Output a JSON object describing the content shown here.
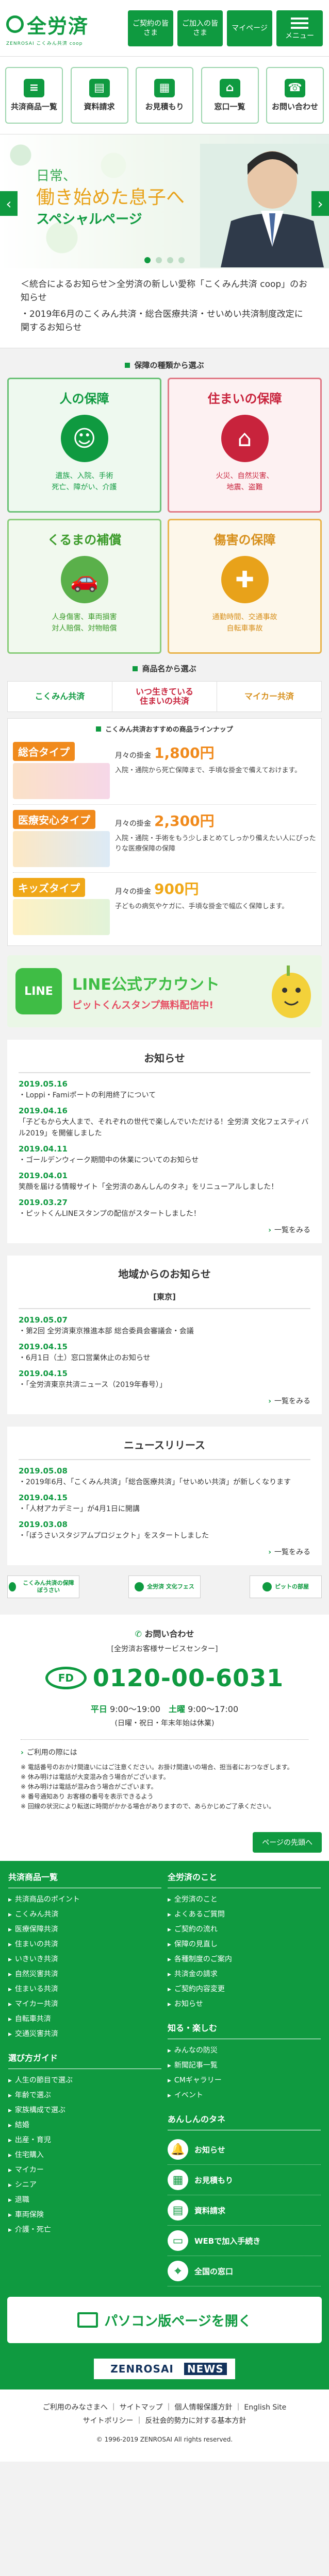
{
  "header": {
    "logo_text": "全労済",
    "logo_sub": "ZENROSAI こくみん共済 coop",
    "buttons": [
      "ご契約の皆さま",
      "ご加入の皆さま",
      "マイページ"
    ],
    "menu_label": "メニュー"
  },
  "nav": [
    {
      "label": "共済商品一覧",
      "icon": "list-icon"
    },
    {
      "label": "資料請求",
      "icon": "document-icon"
    },
    {
      "label": "お見積もり",
      "icon": "calculator-icon"
    },
    {
      "label": "窓口一覧",
      "icon": "shop-icon"
    },
    {
      "label": "お問い合わせ",
      "icon": "headset-icon"
    }
  ],
  "hero": {
    "line1": "日常、",
    "line2": "働き始めた息子へ",
    "line3": "スペシャルページ"
  },
  "notices": [
    "＜統合によるお知らせ＞全労済の新しい愛称「こくみん共済 coop」のお知らせ",
    "・2019年6月のこくみん共済・総合医療共済・せいめい共済制度改定に関するお知らせ"
  ],
  "products": {
    "section_title": "保障の種類から選ぶ",
    "cards": [
      {
        "title": "人の保障",
        "desc": "遺族、入院、手術\n死亡、障がい、介護",
        "icon": "person-icon"
      },
      {
        "title": "住まいの保障",
        "desc": "火災、自然災害、\n地震、盗難",
        "icon": "house-icon"
      },
      {
        "title": "くるまの補償",
        "desc": "人身傷害、車両損害\n対人賠償、対物賠償",
        "icon": "car-icon"
      },
      {
        "title": "傷害の保障",
        "desc": "通勤時間、交通事故\n自転車事故",
        "icon": "bandage-icon"
      }
    ],
    "name_title": "商品名から選ぶ",
    "tabs": [
      "こくみん共済",
      "いつ生きている\n住まいの共済",
      "マイカー共済"
    ],
    "plans_title": "こくみん共済おすすめの商品ラインナップ",
    "plans": [
      {
        "tag": "総合タイプ",
        "price_label": "月々の掛金",
        "price": "1,800円",
        "desc": "入院・通院から死亡保障まで、手頃な掛金で備えておけます。"
      },
      {
        "tag": "医療安心タイプ",
        "price_label": "月々の掛金",
        "price": "2,300円",
        "desc": "入院・通院・手術をもう少しまとめてしっかり備えたい人にぴったりな医療保障の保障"
      },
      {
        "tag": "キッズタイプ",
        "price_label": "月々の掛金",
        "price": "900円",
        "desc": "子どもの病気やケガに、手頃な掛金で幅広く保障します。"
      }
    ]
  },
  "line_banner": {
    "logo": "LINE",
    "title": "LINE公式アカウント",
    "sub": "ピットくんスタンプ無料配信中!"
  },
  "news": {
    "title": "お知らせ",
    "items": [
      {
        "date": "2019.05.16",
        "text": "・Loppi・Famiポートの利用終了について"
      },
      {
        "date": "2019.04.16",
        "text": "「子どもから大人まで、それぞれの世代で楽しんでいただける！全労済 文化フェスティバル2019」を開催しました"
      },
      {
        "date": "2019.04.11",
        "text": "・ゴールデンウィーク期間中の休業についてのお知らせ"
      },
      {
        "date": "2019.04.01",
        "text": "笑顔を届ける情報サイト「全労済のあんしんのタネ」をリニューアルしました！"
      },
      {
        "date": "2019.03.27",
        "text": "・ピットくんLINEスタンプの配信がスタートしました！"
      }
    ],
    "more": "一覧をみる"
  },
  "local_news": {
    "title": "地域からのお知らせ",
    "region": "[東京]",
    "items": [
      {
        "date": "2019.05.07",
        "text": "・第2回 全労済東京推進本部 総合委員会審議会・会議"
      },
      {
        "date": "2019.04.15",
        "text": "・6月1日（土）窓口営業休止のお知らせ"
      },
      {
        "date": "2019.04.15",
        "text": "・「全労済東京共済ニュース（2019年春号）」"
      }
    ],
    "more": "一覧をみる"
  },
  "releases": {
    "title": "ニュースリリース",
    "items": [
      {
        "date": "2019.05.08",
        "text": "・2019年6月、「こくみん共済」「総合医療共済」「せいめい共済」が新しくなります"
      },
      {
        "date": "2019.04.15",
        "text": "・「人材アカデミー」が4月1日に開講"
      },
      {
        "date": "2019.03.08",
        "text": "・「ぼうさいスタジアムプロジェクト」をスタートしました"
      }
    ],
    "more": "一覧をみる"
  },
  "banners": [
    "こくみん共済の保障 ぼうさい",
    "全労済 文化フェス",
    "ピットの部屋"
  ],
  "contact": {
    "heading": "お問い合わせ",
    "sub": "[全労済お客様サービスセンター]",
    "phone": "0120-00-6031",
    "hours_weekday_label": "平日",
    "hours_weekday": "9:00〜19:00",
    "hours_sat_label": "土曜",
    "hours_sat": "9:00〜17:00",
    "closed": "(日曜・祝日・年末年始は休業)",
    "warn_link": "ご利用の際には",
    "notes": "※ 電話番号のおかけ間違いにはご注意ください。お掛け間違いの場合、担当者におつなぎします。\n※ 休み明けは電話が大変混み合う場合がございます。\n※ 休み明けは電話が混み合う場合がございます。\n※ 番号通知あり  お客様の番号を表示できるよう\n※ 回線の状況により転送に時間がかかる場合がありますので、あらかじめご了承ください。"
  },
  "to_top": "ページの先頭へ",
  "sitemap": {
    "col1_title": "共済商品一覧",
    "col1_links": [
      "共済商品のポイント",
      "こくみん共済",
      "医療保障共済",
      "住まいの共済",
      "いきいき共済",
      "自然災害共済",
      "住まいる共済",
      "マイカー共済",
      "自転車共済",
      "交通災害共済"
    ],
    "col2_title": "全労済のこと",
    "col2_links": [
      "全労済のこと",
      "よくあるご質問",
      "ご契約の流れ",
      "保障の見直し",
      "各種制度のご案内",
      "共済金の請求",
      "ご契約内容変更",
      "お知らせ"
    ],
    "col3_title": "選び方ガイド",
    "col3_links": [
      "人生の節目で選ぶ",
      "年齢で選ぶ",
      "家族構成で選ぶ",
      "結婚",
      "出産・育児",
      "住宅購入",
      "マイカー",
      "シニア",
      "退職",
      "車両保険",
      "介護・死亡"
    ],
    "col4_title": "知る・楽しむ",
    "col4_links": [
      "みんなの防災",
      "新聞記事一覧",
      "CMギャラリー",
      "イベント"
    ],
    "col5_title": "あんしんのタネ",
    "icon_rows": [
      {
        "label": "お知らせ",
        "icon": "bell-icon"
      },
      {
        "label": "お見積もり",
        "icon": "calculator-icon"
      },
      {
        "label": "資料請求",
        "icon": "document-icon"
      },
      {
        "label": "WEBで加入手続き",
        "icon": "computer-icon"
      },
      {
        "label": "全国の窓口",
        "icon": "map-pin-icon"
      }
    ]
  },
  "pc_view": "パソコン版ページを開く",
  "footer_logo": "ZENROSAI",
  "footer_logo_badge": "NEWS",
  "footer_links": "ご利用のみなさまへ ｜ サイトマップ ｜ 個人情報保護方針 ｜ English Site",
  "footer_links2": "サイトポリシー ｜ 反社会的勢力に対する基本方針",
  "copyright": "© 1996-2019 ZENROSAI All rights reserved.",
  "colors": {
    "brand": "#0f9a40",
    "people": "#0f9a40",
    "home": "#c8233c",
    "car": "#5ab04a",
    "injury": "#e8a21a"
  }
}
